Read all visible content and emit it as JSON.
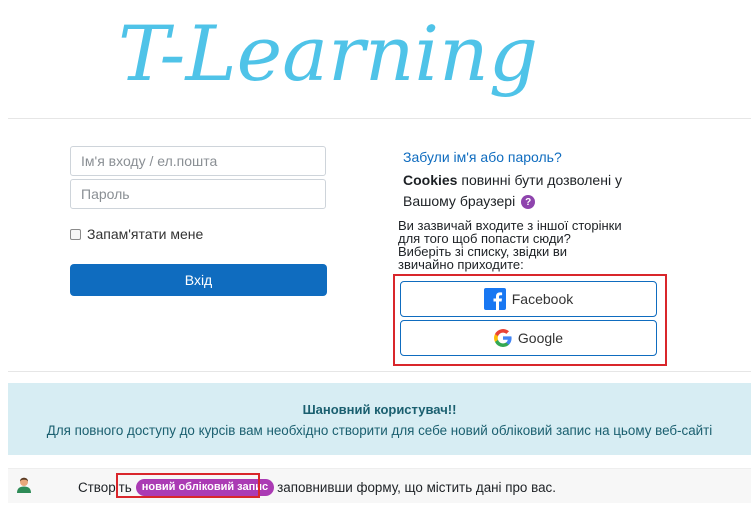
{
  "logo": {
    "text": "T-Learning",
    "color": "#4fc3e8"
  },
  "login": {
    "username_placeholder": "Ім'я входу / ел.пошта",
    "password_placeholder": "Пароль",
    "remember_label": "Запам'ятати мене",
    "submit_label": "Вхід"
  },
  "side": {
    "forgot_link": "Забули ім'я або пароль?",
    "cookies_bold": "Cookies",
    "cookies_line1": " повинні бути дозволені у",
    "cookies_line2": "Вашому браузері",
    "help_icon": "question-circle-icon",
    "idp_line1": "Ви зазвичай входите з іншої сторінки",
    "idp_line2": "для того щоб попасти сюди?",
    "idp_line3": "Виберіть зі списку, звідки ви",
    "idp_line4": "звичайно приходите:",
    "facebook_label": "Facebook",
    "google_label": "Google"
  },
  "notice": {
    "title": "Шановний користувач!!",
    "body": "Для повного доступу до курсів вам необхідно створити для себе новий обліковий запис на цьому веб-сайті"
  },
  "signup": {
    "prefix": "Створіть",
    "link": "новий обліковий запис",
    "suffix": "заповнивши форму, що містить дані про вас."
  },
  "colors": {
    "primary": "#0f6cbf",
    "highlight": "#d9262b",
    "badge": "#ab3bb4",
    "notice_bg": "#d7edf3"
  }
}
